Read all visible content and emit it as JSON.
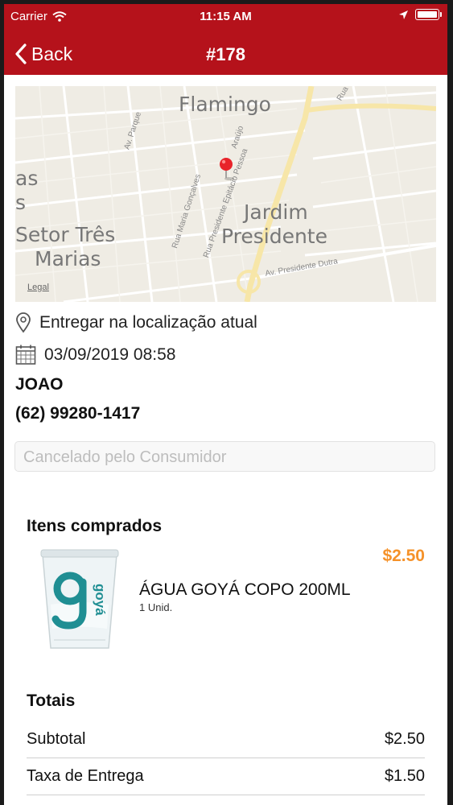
{
  "status_bar": {
    "carrier": "Carrier",
    "time": "11:15 AM"
  },
  "nav": {
    "back_label": "Back",
    "title": "#178"
  },
  "map": {
    "area_labels": [
      "Flamingo",
      "Jardim",
      "Presidente",
      "Setor Três",
      "Marias",
      "as",
      "s"
    ],
    "street_labels": [
      "Av. Parque",
      "Rua Maria Gonçalves",
      "Rua Presidente Epitácio Pessoa",
      "Araújo",
      "Av. Presidente Dutra",
      "Rua"
    ],
    "legal_label": "Legal"
  },
  "delivery": {
    "location_text": "Entregar na localização atual",
    "datetime": "03/09/2019 08:58"
  },
  "customer": {
    "name": "JOAO",
    "phone": "(62) 99280-1417"
  },
  "order_status": {
    "placeholder": "Cancelado pelo Consumidor"
  },
  "items_section": {
    "title": "Itens comprados",
    "items": [
      {
        "name": "ÁGUA GOYÁ COPO 200ML",
        "qty": "1 Unid.",
        "price": "$2.50",
        "brand": "goyá"
      }
    ]
  },
  "totals": {
    "title": "Totais",
    "rows": [
      {
        "label": "Subtotal",
        "value": "$2.50"
      },
      {
        "label": "Taxa de Entrega",
        "value": "$1.50"
      }
    ]
  },
  "colors": {
    "nav_bg": "#b5121b",
    "price": "#f5922a",
    "map_pin": "#e8232a",
    "brand_teal": "#1f8e93"
  },
  "icons": [
    "chevron-left-icon",
    "wifi-icon",
    "location-arrow-icon",
    "battery-icon",
    "map-pin-icon",
    "location-pin-icon",
    "calendar-icon"
  ]
}
